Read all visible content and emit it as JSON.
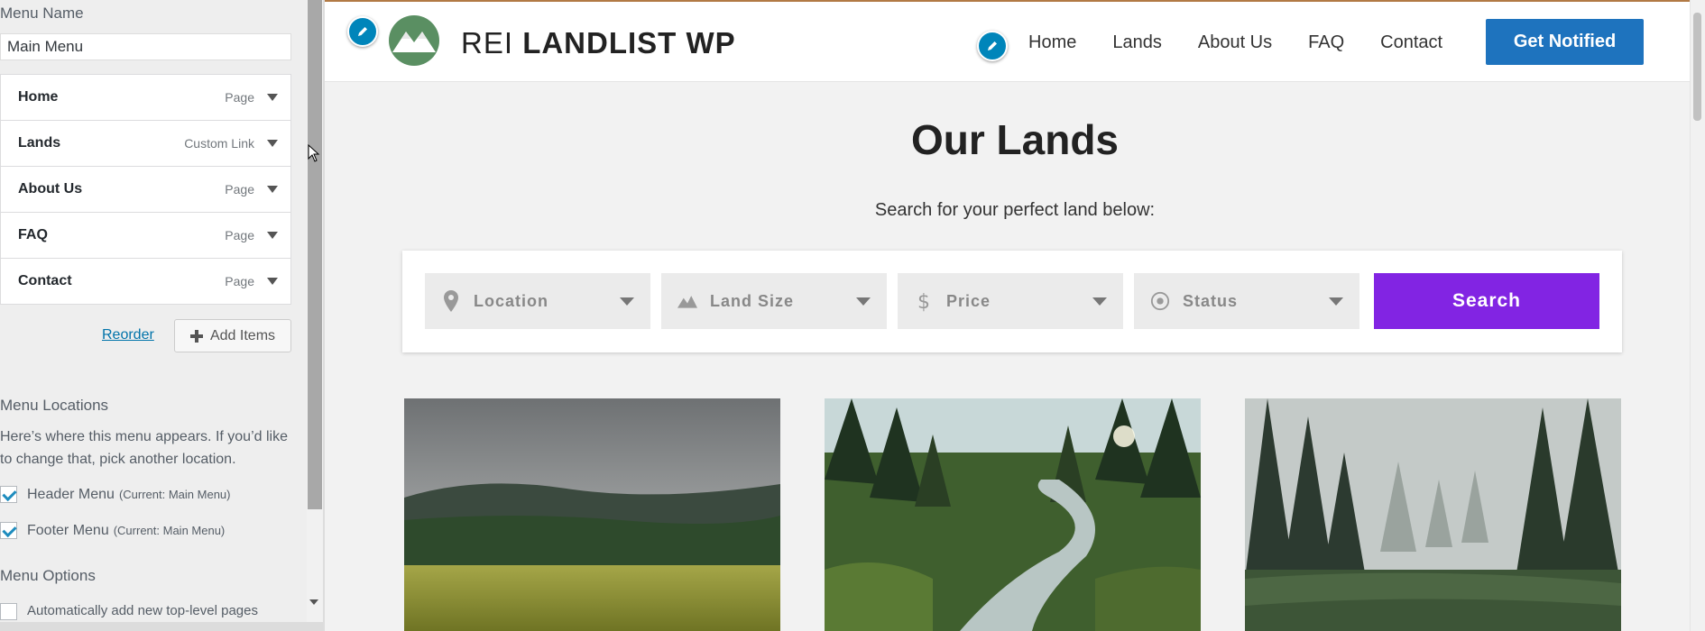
{
  "sidebar": {
    "menu_name_label": "Menu Name",
    "menu_name_value": "Main Menu",
    "items": [
      {
        "title": "Home",
        "type": "Page"
      },
      {
        "title": "Lands",
        "type": "Custom Link"
      },
      {
        "title": "About Us",
        "type": "Page"
      },
      {
        "title": "FAQ",
        "type": "Page"
      },
      {
        "title": "Contact",
        "type": "Page"
      }
    ],
    "reorder_label": "Reorder",
    "add_items_label": "Add Items",
    "locations_heading": "Menu Locations",
    "locations_description": "Here’s where this menu appears. If you’d like to change that, pick another location.",
    "locations": [
      {
        "label": "Header Menu",
        "current": "(Current: Main Menu)",
        "checked": true
      },
      {
        "label": "Footer Menu",
        "current": "(Current: Main Menu)",
        "checked": true
      }
    ],
    "options_heading": "Menu Options",
    "auto_add_label": "Automatically add new top-level pages"
  },
  "site": {
    "title_light": "REI",
    "title_bold": "LANDLIST WP",
    "nav": [
      "Home",
      "Lands",
      "About Us",
      "FAQ",
      "Contact"
    ],
    "cta_label": "Get Notified",
    "heading": "Our Lands",
    "subheading": "Search for your perfect land below:",
    "filters": [
      {
        "label": "Location",
        "icon": "map-pin-icon"
      },
      {
        "label": "Land Size",
        "icon": "mountain-icon"
      },
      {
        "label": "Price",
        "icon": "dollar-icon"
      },
      {
        "label": "Status",
        "icon": "target-icon"
      }
    ],
    "search_label": "Search"
  },
  "colors": {
    "cta_blue": "#1e73be",
    "search_purple": "#8224e3",
    "edit_shortcut_blue": "#0085ba",
    "header_border": "#b27a45"
  }
}
